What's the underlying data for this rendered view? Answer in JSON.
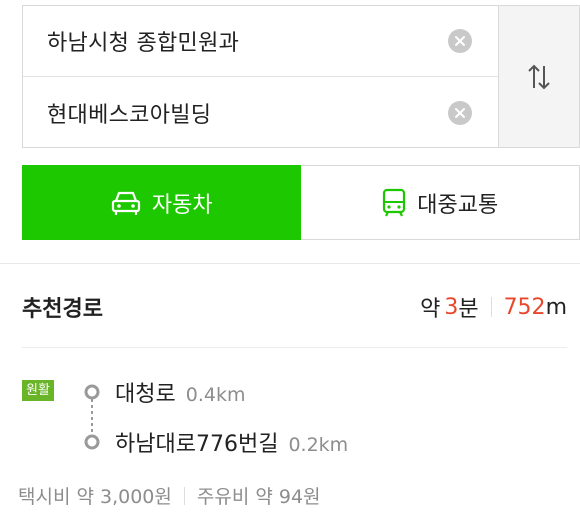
{
  "search": {
    "origin": "하남시청 종합민원과",
    "destination": "현대베스코아빌딩"
  },
  "icons": {
    "clear": "clear-icon",
    "swap": "swap-arrows-icon",
    "car": "car-icon",
    "bus": "bus-icon",
    "waypoint": "waypoint-dot-icon"
  },
  "modes": [
    {
      "label": "자동차",
      "active": true
    },
    {
      "label": "대중교통",
      "active": false
    }
  ],
  "route": {
    "title": "추천경로",
    "summary_prefix": "약",
    "time_value": "3",
    "time_unit": "분",
    "distance_value": "752",
    "distance_unit": "m",
    "traffic_badge": "원활",
    "steps": [
      {
        "name": "대청로",
        "distance": "0.4km"
      },
      {
        "name": "하남대로776번길",
        "distance": "0.2km"
      }
    ],
    "taxi_fare": "택시비 약 3,000원",
    "fuel_cost": "주유비 약 94원"
  },
  "colors": {
    "accent_green": "#1ec800",
    "highlight_red": "#e8472b",
    "traffic_green": "#6ab427"
  }
}
